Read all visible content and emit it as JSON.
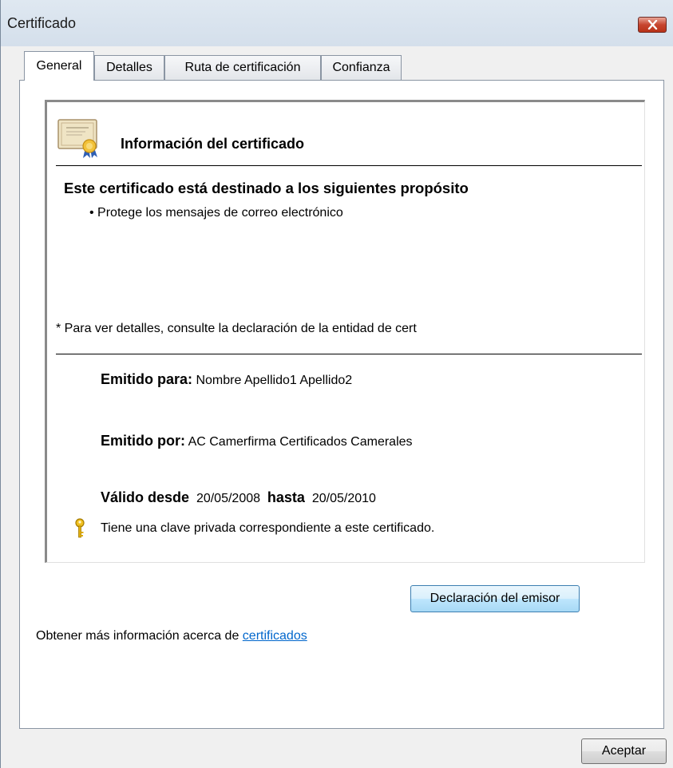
{
  "window": {
    "title": "Certificado"
  },
  "tabs": [
    {
      "label": "General",
      "active": true
    },
    {
      "label": "Detalles",
      "active": false
    },
    {
      "label": "Ruta de certificación",
      "active": false
    },
    {
      "label": "Confianza",
      "active": false
    }
  ],
  "info": {
    "title": "Información del certificado",
    "purpose_heading": "Este certificado está destinado a los siguientes propósito",
    "purposes": [
      "• Protege los mensajes de correo electrónico"
    ],
    "footnote": "* Para ver detalles, consulte la declaración de la entidad de cert",
    "issued_to_label": "Emitido para:",
    "issued_to_value": "Nombre Apellido1 Apellido2",
    "issued_by_label": "Emitido por:",
    "issued_by_value": "AC Camerfirma Certificados Camerales",
    "valid_from_label": "Válido desde",
    "valid_from_value": "20/05/2008",
    "valid_to_label": "hasta",
    "valid_to_value": "20/05/2010",
    "private_key_note": "Tiene una clave privada correspondiente a este certificado."
  },
  "buttons": {
    "issuer_statement": "Declaración del emisor",
    "ok": "Aceptar"
  },
  "more_info": {
    "text": "Obtener más información acerca de ",
    "link": "certificados"
  },
  "icons": {
    "certificate": "certificate-icon",
    "key": "key-icon",
    "close": "close-icon"
  },
  "colors": {
    "link": "#0066cc",
    "close_button": "#c7452f",
    "key": "#d9a400"
  }
}
